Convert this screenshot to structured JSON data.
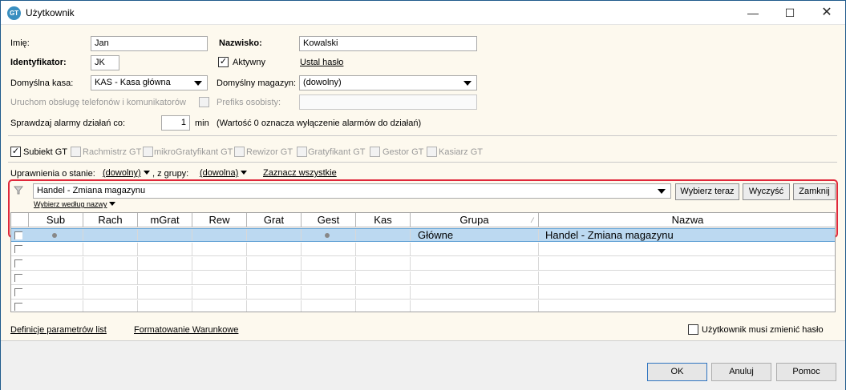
{
  "window": {
    "title": "Użytkownik",
    "app_icon_text": "GT",
    "minimize": "—",
    "maximize": "☐",
    "close": "✕"
  },
  "form": {
    "first_name_label": "Imię:",
    "first_name_value": "Jan",
    "last_name_label": "Nazwisko:",
    "last_name_value": "Kowalski",
    "id_label": "Identyfikator:",
    "id_value": "JK",
    "active_label": "Aktywny",
    "active_checked": true,
    "set_password_link": "Ustal hasło",
    "cash_label": "Domyślna kasa:",
    "cash_value": "KAS - Kasa główna",
    "warehouse_label": "Domyślny magazyn:",
    "warehouse_value": "(dowolny)",
    "phone_label": "Uruchom obsługę telefonów i komunikatorów",
    "prefix_label": "Prefiks osobisty:",
    "prefix_value": "",
    "alarm_label": "Sprawdzaj alarmy działań co:",
    "alarm_value": "1",
    "alarm_unit": "min",
    "alarm_note": "(Wartość 0 oznacza wyłączenie alarmów do działań)"
  },
  "modules": [
    {
      "label": "Subiekt GT",
      "checked": true,
      "enabled": true
    },
    {
      "label": "Rachmistrz GT",
      "checked": false,
      "enabled": false
    },
    {
      "label": "mikroGratyfikant GT",
      "checked": false,
      "enabled": false
    },
    {
      "label": "Rewizor GT",
      "checked": false,
      "enabled": false
    },
    {
      "label": "Gratyfikant GT",
      "checked": false,
      "enabled": false
    },
    {
      "label": "Gestor GT",
      "checked": false,
      "enabled": false
    },
    {
      "label": "Kasiarz GT",
      "checked": false,
      "enabled": false
    }
  ],
  "permissions": {
    "state_label": "Uprawnienia o stanie:",
    "state_value": "(dowolny)",
    "group_label": ", z grupy:",
    "group_value": "(dowolna)",
    "select_all": "Zaznacz wszystkie",
    "filter_value": "Handel - Zmiana magazynu",
    "choose_now": "Wybierz teraz",
    "clear": "Wyczyść",
    "close": "Zamknij",
    "by_name": "Wybierz według nazwy"
  },
  "grid": {
    "columns": [
      "Sub",
      "Rach",
      "mGrat",
      "Rew",
      "Grat",
      "Gest",
      "Kas",
      "Grupa",
      "Nazwa"
    ],
    "rows": [
      {
        "group": "Główne",
        "name": "Handel - Zmiana magazynu",
        "dots": [
          "Sub",
          "Gest"
        ],
        "selected": true
      }
    ]
  },
  "links": {
    "param_defs": "Definicje parametrów list",
    "cond_format": "Formatowanie Warunkowe"
  },
  "must_change_pwd": "Użytkownik musi zmienić hasło",
  "buttons": {
    "ok": "OK",
    "cancel": "Anuluj",
    "help": "Pomoc"
  }
}
